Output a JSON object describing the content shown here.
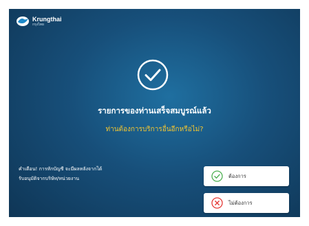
{
  "brand": {
    "name": "Krungthai",
    "sub": "กรุงไทย",
    "logo_icon": "krungthai-bird-logo"
  },
  "main": {
    "success_icon": "check-circle-icon",
    "title": "รายการของท่านเสร็จสมบูรณ์แล้ว",
    "question": "ท่านต้องการบริการอื่นอีกหรือไม่?"
  },
  "warning": {
    "line1": "คำเตือน! การหักบัญชี จะมีผลหลังจากได้",
    "line2": "รับอนุมัติจากบริษัท/หน่วยงาน"
  },
  "buttons": {
    "yes_label": "ต้องการ",
    "no_label": "ไม่ต้องการ",
    "yes_icon": "check-circle-icon",
    "no_icon": "x-circle-icon"
  },
  "colors": {
    "background": "#174f7a",
    "question_text": "#f2c531",
    "yes_accent": "#4caf50",
    "no_accent": "#e53935"
  }
}
